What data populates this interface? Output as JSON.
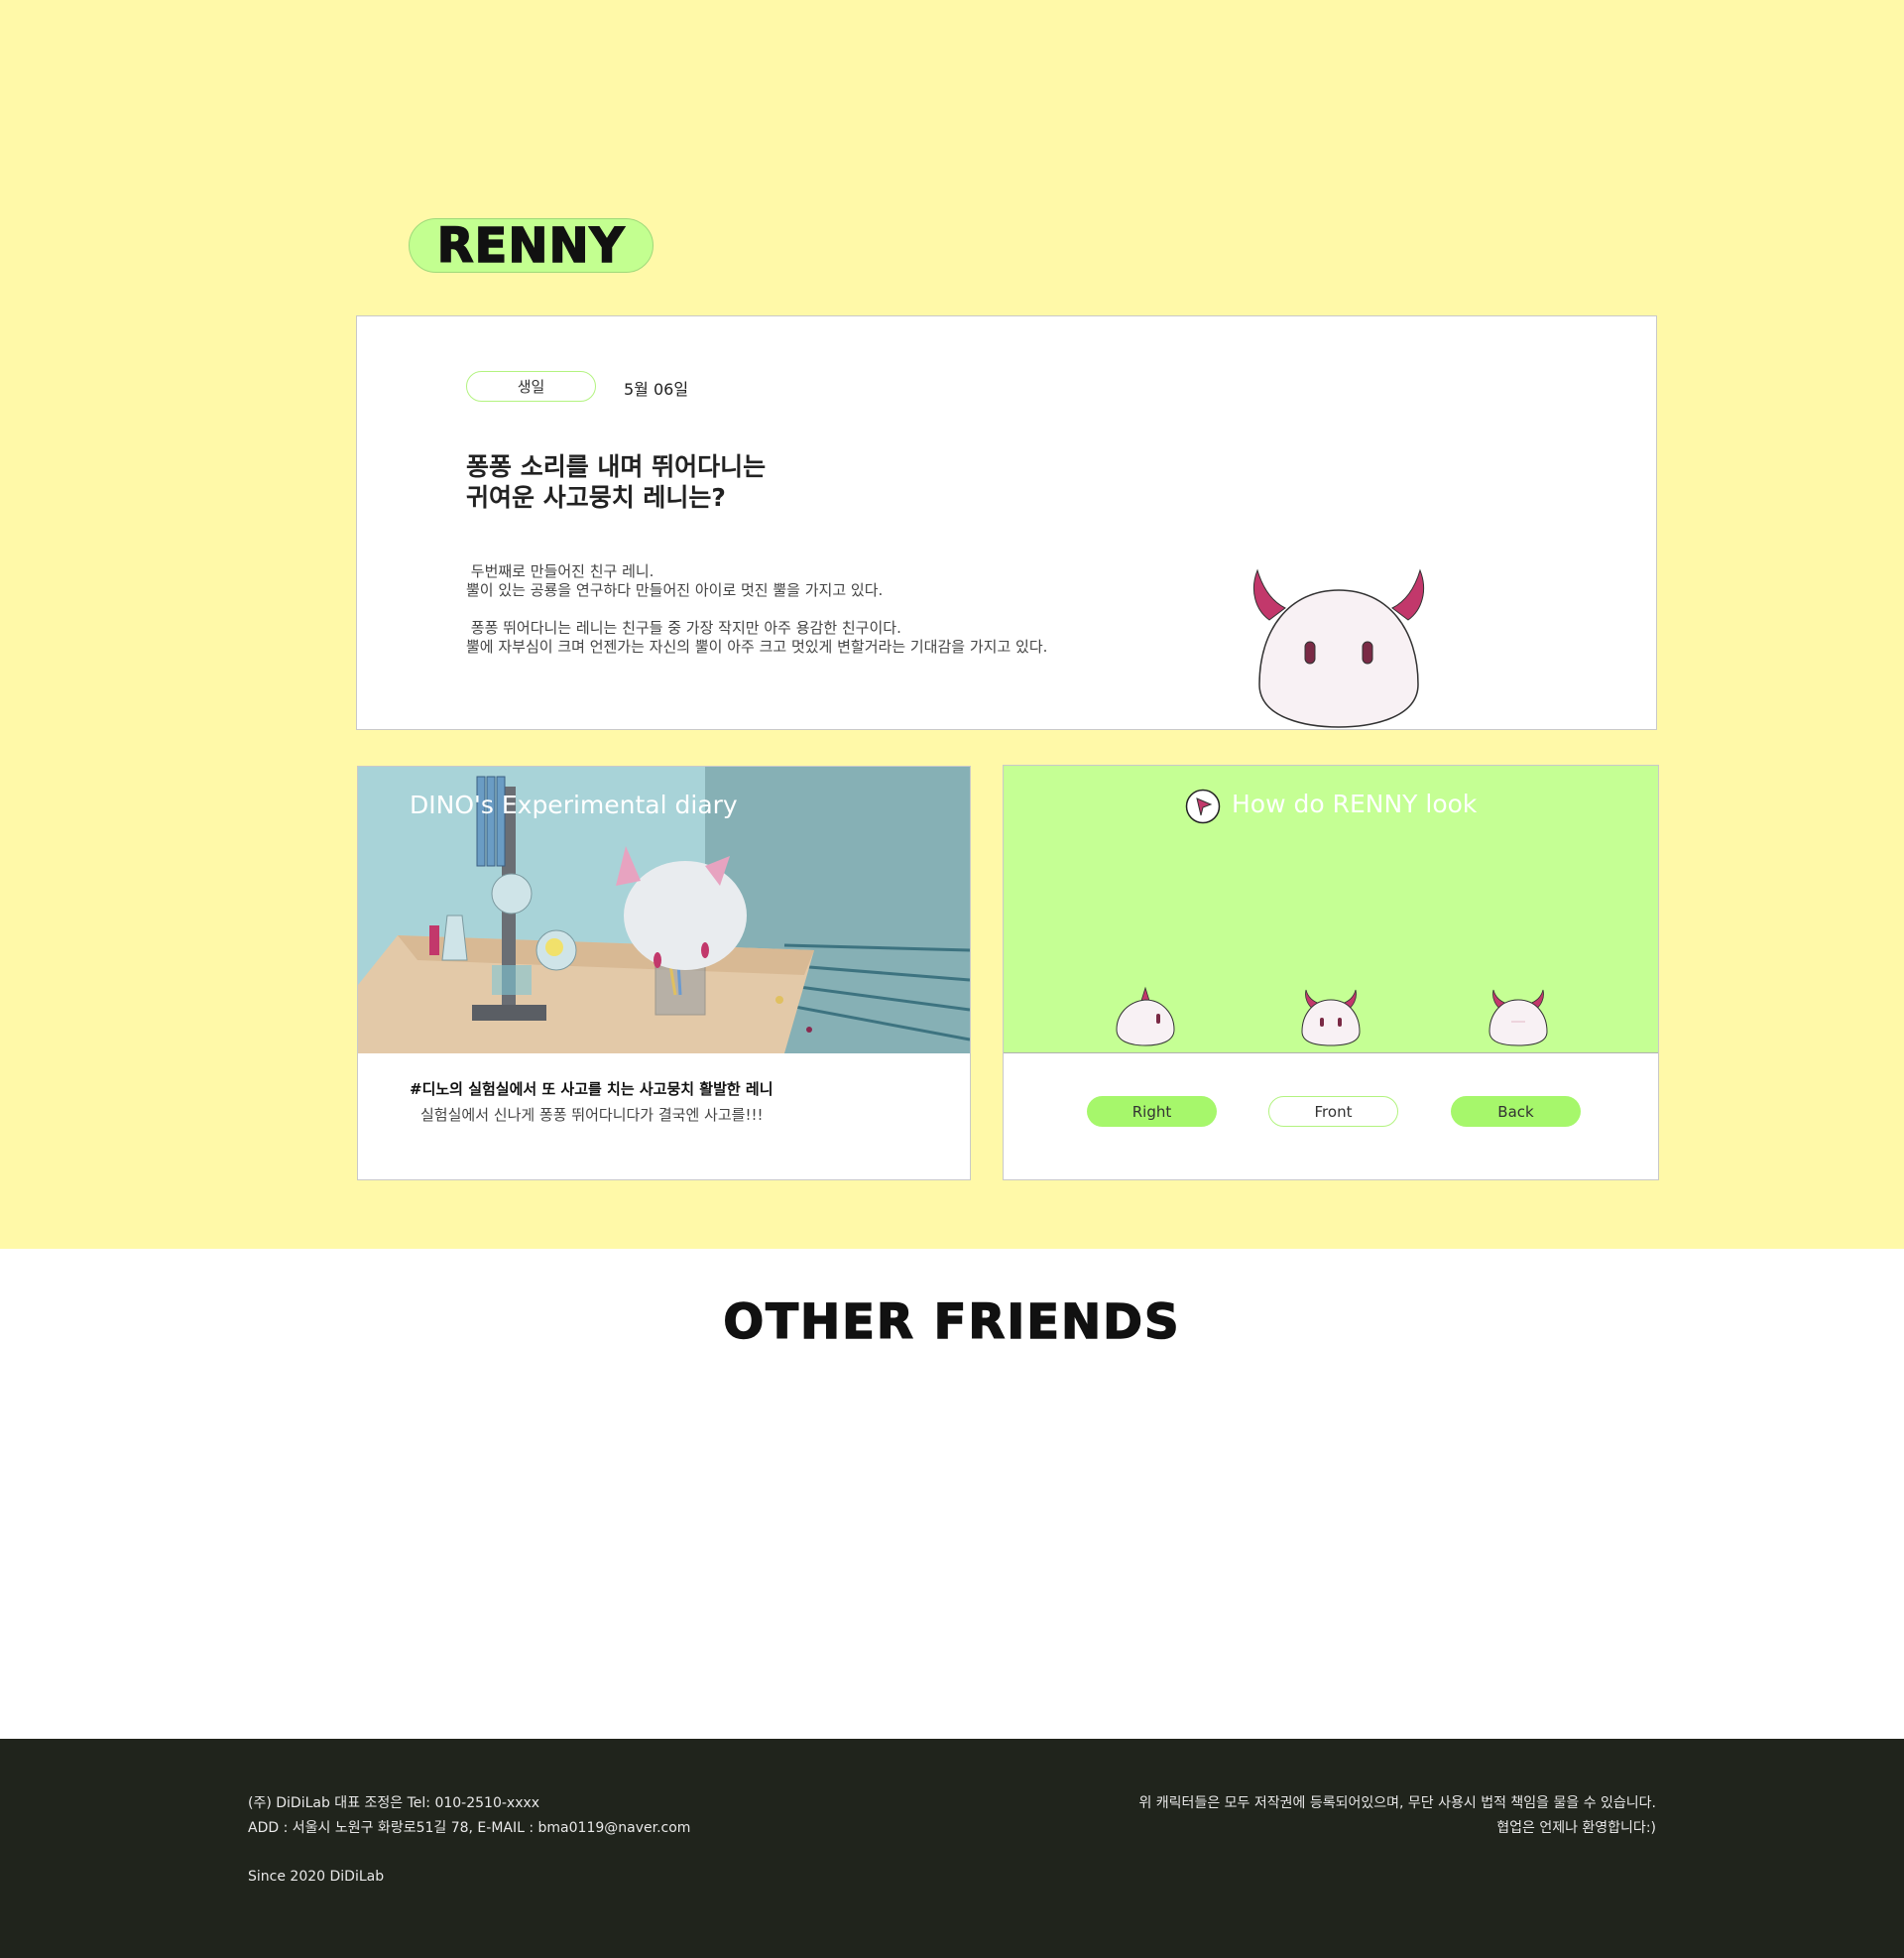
{
  "header": {
    "title": "RENNY"
  },
  "profile": {
    "birthday_label": "생일",
    "birthday_value": "5월 06일",
    "headline_line1": "퐁퐁 소리를 내며 뛰어다니는",
    "headline_line2": "귀여운 사고뭉치 레니는?",
    "desc_line1": " 두번째로 만들어진 친구 레니.",
    "desc_line2": "뿔이 있는 공룡을 연구하다 만들어진 아이로 멋진 뿔을 가지고 있다.",
    "desc_line3": " 퐁퐁 뛰어다니는 레니는 친구들 중 가장 작지만 아주 용감한 친구이다.",
    "desc_line4": "뿔에 자부심이 크며 언젠가는 자신의 뿔이 아주 크고 멋있게 변할거라는 기대감을 가지고 있다."
  },
  "diary": {
    "title": "DINO's Experimental diary",
    "subtitle": "#디노의 실험실에서 또 사고를 치는 사고뭉치 활발한 레니",
    "caption": "실험실에서 신나게 퐁퐁 뛰어다니다가 결국엔 사고를!!!"
  },
  "look": {
    "title": "How do RENNY look",
    "buttons": [
      "Right",
      "Front",
      "Back"
    ]
  },
  "other_friends": {
    "title": "OTHER FRIENDS"
  },
  "footer": {
    "line1": "(주) DiDiLab 대표 조정은 Tel: 010-2510-xxxx",
    "line2": "ADD : 서울시 노원구 화랑로51길 78, E-MAIL : bma0119@naver.com",
    "line3": "Since 2020 DiDiLab",
    "right1": "위 캐릭터들은 모두 저작권에 등록되어있으며, 무단 사용시 법적 책임을 물을 수 있습니다.",
    "right2": "협업은 언제나 환영합니다:)"
  },
  "colors": {
    "page_bg": "#fff9a8",
    "accent_green": "#c5ff94",
    "button_green": "#a6f76b",
    "horn": "#c2386b",
    "footer_bg": "#20241c"
  }
}
